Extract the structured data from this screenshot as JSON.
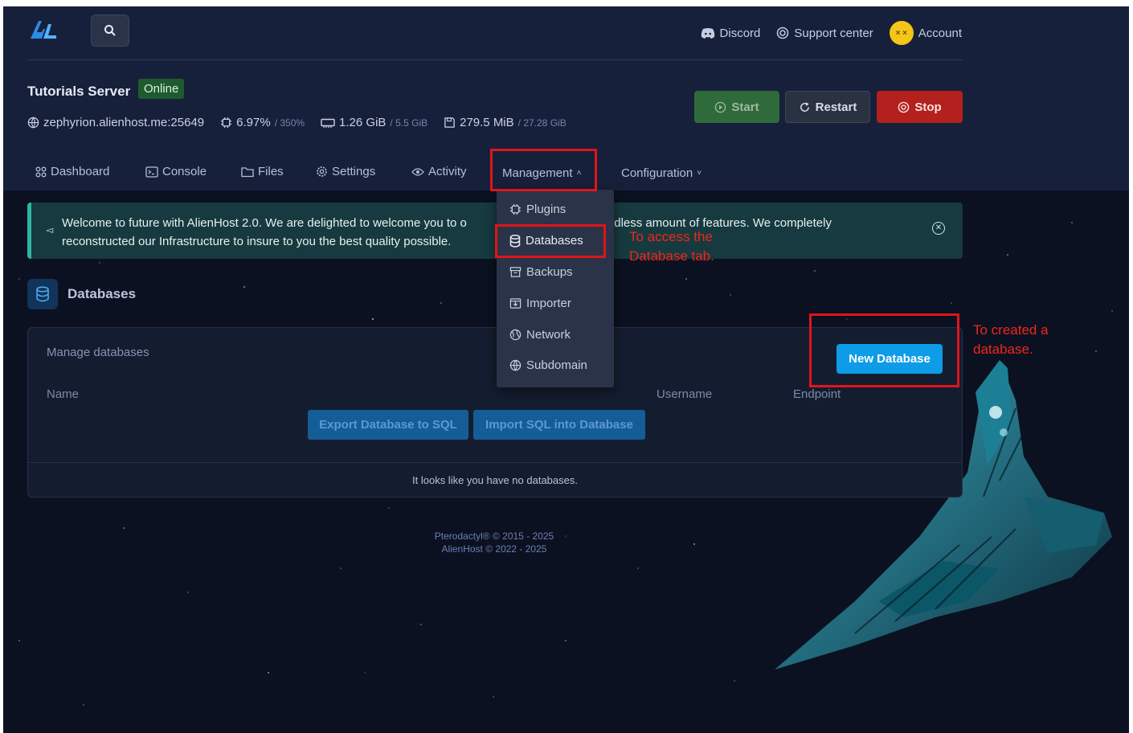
{
  "header": {
    "links": [
      {
        "label": "Discord",
        "icon": "discord-icon"
      },
      {
        "label": "Support center",
        "icon": "lifebuoy-icon"
      },
      {
        "label": "Account",
        "icon": "avatar"
      }
    ]
  },
  "server": {
    "name": "Tutorials Server",
    "status": "Online",
    "address": "zephyrion.alienhost.me:25649",
    "cpu": {
      "used": "6.97%",
      "max": "/ 350%"
    },
    "memory": {
      "used": "1.26 GiB",
      "max": "/ 5.5 GiB"
    },
    "disk": {
      "used": "279.5 MiB",
      "max": "/ 27.28 GiB"
    }
  },
  "power": {
    "start": "Start",
    "restart": "Restart",
    "stop": "Stop"
  },
  "nav": {
    "dashboard": "Dashboard",
    "console": "Console",
    "files": "Files",
    "settings": "Settings",
    "activity": "Activity",
    "management": "Management",
    "configuration": "Configuration"
  },
  "dropdown": {
    "items": [
      "Plugins",
      "Databases",
      "Backups",
      "Importer",
      "Network",
      "Subdomain"
    ]
  },
  "banner": {
    "text_left": "Welcome to future with AlienHost 2.0. We are delighted to welcome you to o",
    "text_right": "th endless amount of features. We completely",
    "text_line2": "reconstructed our Infrastructure to insure to you the best quality possible."
  },
  "page": {
    "title": "Databases",
    "subtitle": "Manage databases",
    "new_database": "New Database",
    "columns": {
      "name": "Name",
      "username": "Username",
      "endpoint": "Endpoint"
    },
    "export_button": "Export Database to SQL",
    "import_button": "Import SQL into Database",
    "empty_message": "It looks like you have no databases."
  },
  "footer": {
    "line1": "Pterodactyl® © 2015 - 2025",
    "line2": "AlienHost © 2022 - 2025"
  },
  "annotations": {
    "database_tab_line1": "To access the",
    "database_tab_line2": "Database tab.",
    "create_line1": "To created a",
    "create_line2": "database."
  },
  "colors": {
    "background": "#0b1120",
    "header": "#17203a",
    "accent_blue": "#0e9be7",
    "stop_red": "#b3201e",
    "start_green": "#2f6b3a",
    "annotation_red": "#e0141b"
  }
}
